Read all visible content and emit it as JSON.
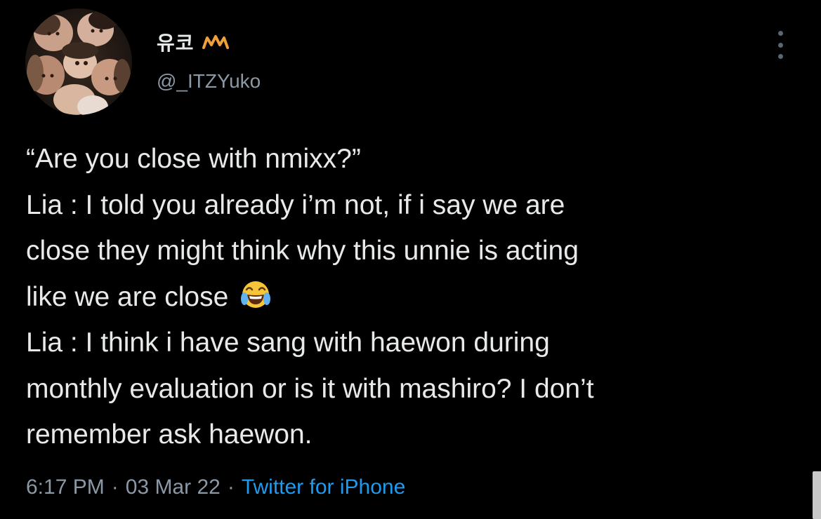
{
  "user": {
    "display_name": "유코",
    "name_emoji": "m-monogram-icon",
    "handle": "@_ITZYuko"
  },
  "tweet": {
    "lines": [
      "“Are you close with nmixx?”",
      "Lia : I told you already i’m not, if i say we are",
      "close they might think why this unnie is acting",
      "like we are close",
      "Lia : I think i have sang with haewon during",
      "monthly evaluation or is it with mashiro? I don’t",
      "remember ask haewon."
    ],
    "inline_emoji": "face-with-tears-of-joy-icon"
  },
  "meta": {
    "time": "6:17 PM",
    "date": "03 Mar 22",
    "separator": "·",
    "source": "Twitter for iPhone"
  },
  "colors": {
    "background": "#000000",
    "text": "#e7e9ea",
    "secondary": "#8b98a5",
    "link": "#1d9bf0",
    "name_emoji": "#f0a03a"
  }
}
